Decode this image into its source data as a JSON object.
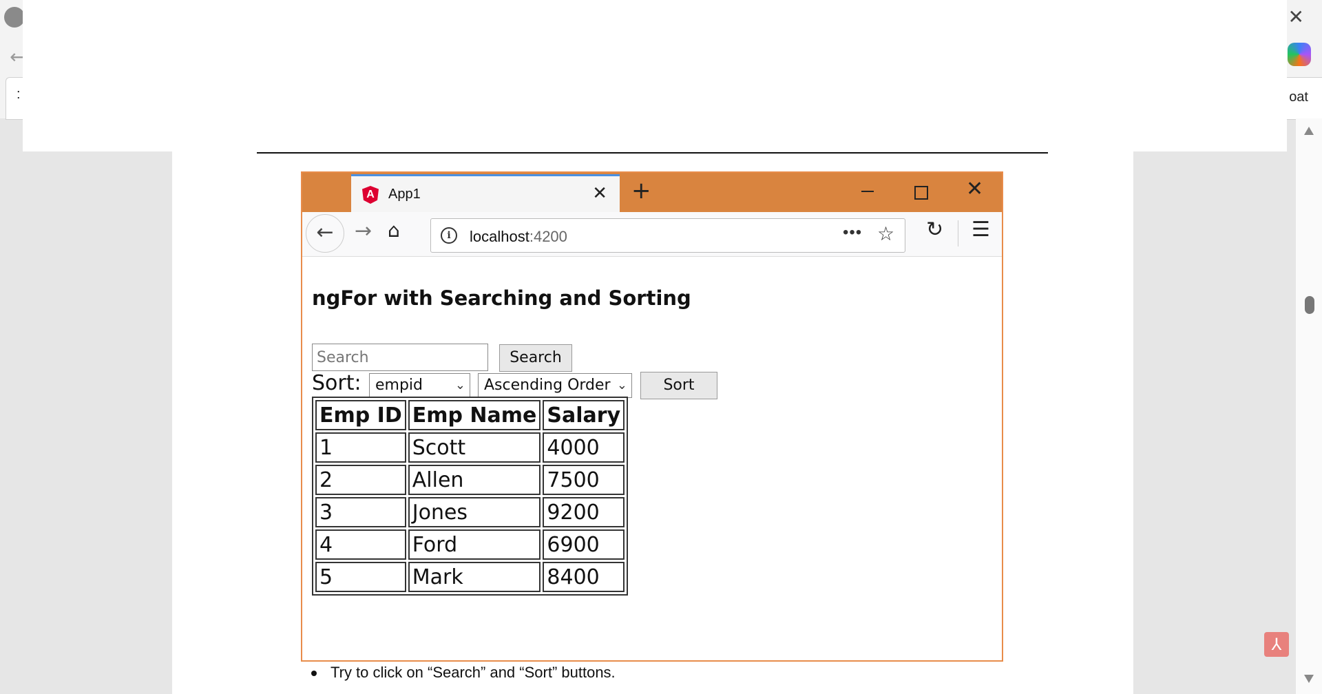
{
  "outer": {
    "right_tab_text": "oat"
  },
  "browser": {
    "tab_title": "App1",
    "url_host": "localhost",
    "url_port": ":4200"
  },
  "page": {
    "heading": "ngFor with Searching and Sorting",
    "search_placeholder": "Search",
    "search_button": "Search",
    "sort_label": "Sort:",
    "sort_field": "empid",
    "sort_order": "Ascending Order",
    "sort_button": "Sort"
  },
  "table": {
    "headers": [
      "Emp ID",
      "Emp Name",
      "Salary"
    ],
    "rows": [
      [
        "1",
        "Scott",
        "4000"
      ],
      [
        "2",
        "Allen",
        "7500"
      ],
      [
        "3",
        "Jones",
        "9200"
      ],
      [
        "4",
        "Ford",
        "6900"
      ],
      [
        "5",
        "Mark",
        "8400"
      ]
    ]
  },
  "document": {
    "bullet": "Try to click on “Search” and “Sort” buttons."
  },
  "colors": {
    "titlebar": "#d9843f",
    "tab_accent": "#4a90e2",
    "angular_red": "#dd0031",
    "pdf_icon": "#e8817d"
  },
  "icons": [
    "user-avatar-icon",
    "back-icon",
    "close-icon",
    "copilot-icon",
    "angular-logo-icon",
    "tab-close-icon",
    "new-tab-icon",
    "minimize-icon",
    "maximize-icon",
    "window-close-icon",
    "nav-back-icon",
    "nav-forward-icon",
    "home-icon",
    "info-icon",
    "more-icon",
    "star-icon",
    "reload-icon",
    "menu-icon",
    "pdf-tools-icon"
  ]
}
